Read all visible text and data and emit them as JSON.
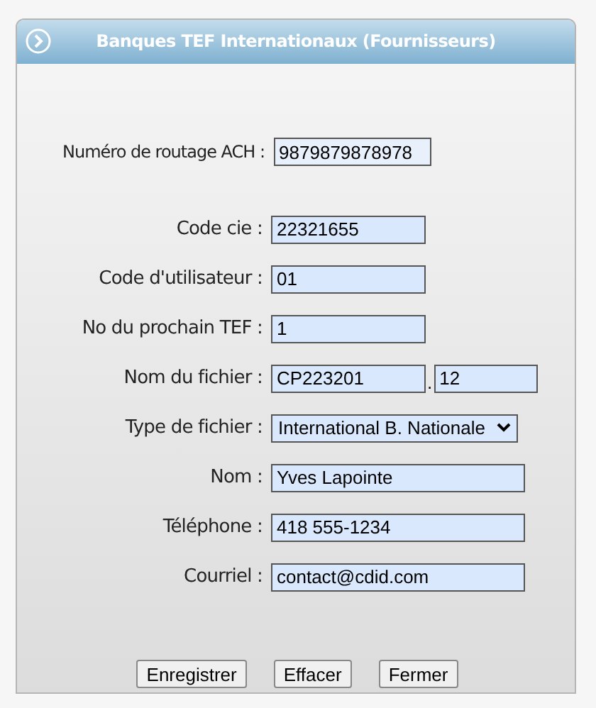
{
  "panel": {
    "title": "Banques TEF Internationaux (Fournisseurs)"
  },
  "routing": {
    "label": "Numéro de routage ACH :",
    "value": "9879879878978"
  },
  "fields": [
    {
      "kind": "short",
      "label": "Code cie :",
      "value": "22321655"
    },
    {
      "kind": "short",
      "label": "Code d'utilisateur :",
      "value": "01"
    },
    {
      "kind": "short",
      "label": "No du prochain TEF :",
      "value": "1"
    },
    {
      "kind": "split",
      "label": "Nom du fichier :",
      "value": "CP223201",
      "separator": ".",
      "extension": "12"
    },
    {
      "kind": "select",
      "label": "Type de fichier :",
      "value": "International B. Nationale"
    },
    {
      "kind": "long",
      "label": "Nom :",
      "value": "Yves Lapointe"
    },
    {
      "kind": "long",
      "label": "Téléphone :",
      "value": "418 555-1234"
    },
    {
      "kind": "long",
      "label": "Courriel :",
      "value": "contact@cdid.com"
    }
  ],
  "buttons": [
    "Enregistrer",
    "Effacer",
    "Fermer"
  ]
}
